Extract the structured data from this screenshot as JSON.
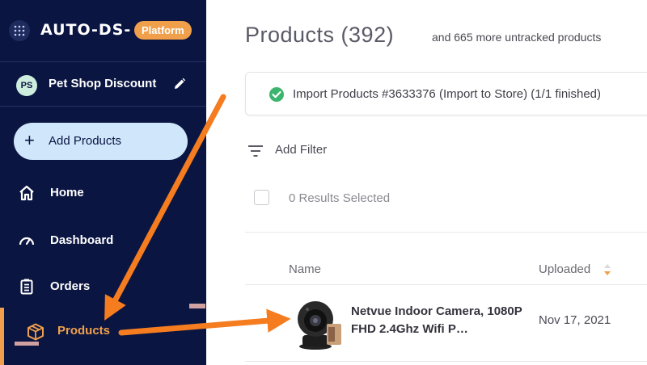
{
  "logo": {
    "text": "AUTO-DS-",
    "badge": "Platform"
  },
  "store": {
    "initials": "PS",
    "name": "Pet Shop Discount"
  },
  "sidebar": {
    "add_button": "Add Products",
    "items": [
      {
        "label": "Home",
        "icon": "home-icon"
      },
      {
        "label": "Dashboard",
        "icon": "gauge-icon"
      },
      {
        "label": "Orders",
        "icon": "clipboard-icon"
      },
      {
        "label": "Products",
        "icon": "box-icon",
        "active": true
      }
    ]
  },
  "page": {
    "title": "Products (392)",
    "subtitle": "and 665 more untracked products"
  },
  "import_banner": {
    "text": "Import Products #3633376 (Import to Store) (1/1 finished)",
    "status": "success"
  },
  "filter": {
    "label": "Add Filter"
  },
  "selection": {
    "text": "0 Results Selected"
  },
  "table": {
    "columns": [
      "Name",
      "Uploaded"
    ],
    "rows": [
      {
        "name": "Netvue Indoor Camera, 1080P FHD 2.4Ghz Wifi P…",
        "uploaded": "Nov 17, 2021"
      }
    ]
  },
  "colors": {
    "sidebar_bg": "#0b1542",
    "accent": "#f0a04b",
    "annotation": "#f57c1f",
    "success": "#3cb46e"
  }
}
